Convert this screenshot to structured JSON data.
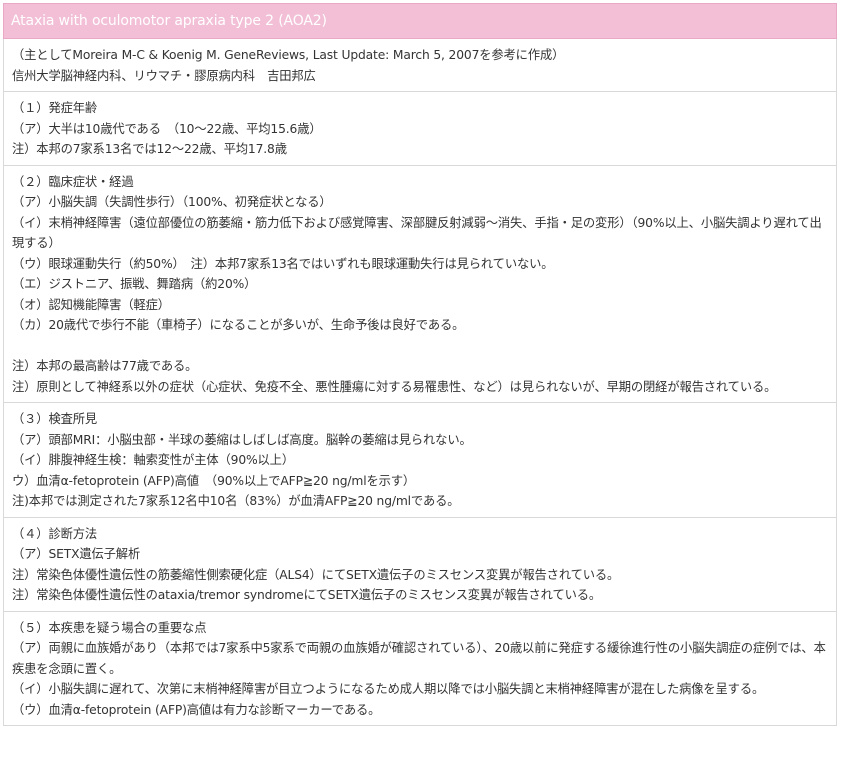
{
  "title": "Ataxia with oculomotor apraxia type 2 (AOA2)",
  "source": {
    "lines": [
      "（主としてMoreira M-C & Koenig M. GeneReviews, Last Update: March 5, 2007を参考に作成）",
      "信州大学脳神経内科、リウマチ・膠原病内科　吉田邦広"
    ]
  },
  "sections": [
    {
      "heading": "（１）発症年齢",
      "lines": [
        "（ア）大半は10歳代である　（10～22歳、平均15.6歳）",
        "注）本邦の7家系13名では12～22歳、平均17.8歳"
      ]
    },
    {
      "heading": "（２）臨床症状・経過",
      "lines": [
        "（ア）小脳失調（失調性歩行）（100%、初発症状となる）",
        "（イ）末梢神経障害（遠位部優位の筋萎縮・筋力低下および感覚障害、深部腱反射減弱～消失、手指・足の変形）（90%以上、小脳失調より遅れて出現する）",
        "（ウ）眼球運動失行（約50%）　注）本邦7家系13名ではいずれも眼球運動失行は見られていない。",
        "（エ）ジストニア、振戦、舞踏病（約20%）",
        "（オ）認知機能障害（軽症）",
        "（カ）20歳代で歩行不能（車椅子）になることが多いが、生命予後は良好である。",
        "",
        "注）本邦の最高齢は77歳である。",
        "注）原則として神経系以外の症状（心症状、免疫不全、悪性腫瘍に対する易罹患性、など）は見られないが、早期の閉経が報告されている。"
      ]
    },
    {
      "heading": "（３）検査所見",
      "lines": [
        "（ア）頭部MRI：小脳虫部・半球の萎縮はしばしば高度。脳幹の萎縮は見られない。",
        "（イ）腓腹神経生検：軸索変性が主体（90%以上）",
        "ウ）血清α-fetoprotein (AFP)高値　（90%以上でAFP≧20 ng/mlを示す）",
        "注)本邦では測定された7家系12名中10名（83%）が血清AFP≧20 ng/mlである。"
      ]
    },
    {
      "heading": "（４）診断方法",
      "lines": [
        "（ア）SETX遺伝子解析",
        "注）常染色体優性遺伝性の筋萎縮性側索硬化症（ALS4）にてSETX遺伝子のミスセンス変異が報告されている。",
        "注）常染色体優性遺伝性のataxia/tremor syndromeにてSETX遺伝子のミスセンス変異が報告されている。"
      ]
    },
    {
      "heading": "（５）本疾患を疑う場合の重要な点",
      "lines": [
        "（ア）両親に血族婚があり（本邦では7家系中5家系で両親の血族婚が確認されている）、20歳以前に発症する緩徐進行性の小脳失調症の症例では、本疾患を念頭に置く。",
        "（イ）小脳失調に遅れて、次第に末梢神経障害が目立つようになるため成人期以降では小脳失調と末梢神経障害が混在した病像を呈する。",
        "（ウ）血清α-fetoprotein (AFP)高値は有力な診断マーカーである。"
      ]
    }
  ]
}
